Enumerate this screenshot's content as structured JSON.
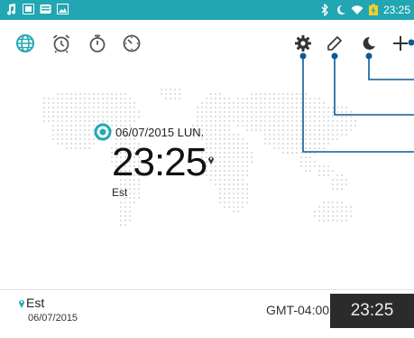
{
  "status_bar": {
    "time": "23:25",
    "left_icons": [
      "music-note-icon",
      "media-icon",
      "message-icon",
      "image-icon"
    ],
    "right_icons": [
      "bluetooth-icon",
      "moon-icon",
      "wifi-icon",
      "battery-charging-icon"
    ]
  },
  "toolbar": {
    "tabs": [
      "world-clock-tab",
      "alarm-tab",
      "stopwatch-tab",
      "timer-tab"
    ],
    "actions": [
      "settings-icon",
      "edit-icon",
      "night-mode-icon",
      "add-icon"
    ]
  },
  "main_clock": {
    "date": "06/07/2015 LUN.",
    "time": "23:25",
    "city": "Est"
  },
  "city_list": [
    {
      "city": "Est",
      "date": "06/07/2015",
      "gmt": "GMT-04:00",
      "time": "23:25"
    }
  ],
  "colors": {
    "accent": "#1fa9b5",
    "status_bar": "#21a6b2",
    "callout_line": "#0b5b96",
    "time_box": "#2b2b2b"
  }
}
